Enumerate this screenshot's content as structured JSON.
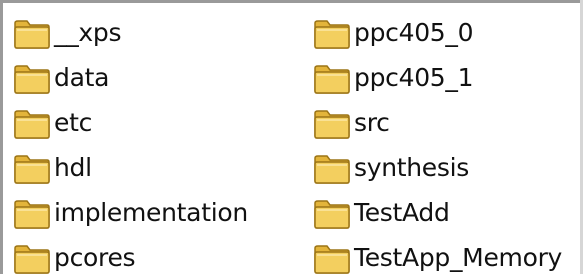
{
  "folders": {
    "left": [
      {
        "label": "__xps"
      },
      {
        "label": "data"
      },
      {
        "label": "etc"
      },
      {
        "label": "hdl"
      },
      {
        "label": "implementation"
      },
      {
        "label": "pcores"
      }
    ],
    "right": [
      {
        "label": "ppc405_0"
      },
      {
        "label": "ppc405_1"
      },
      {
        "label": "src"
      },
      {
        "label": "synthesis"
      },
      {
        "label": "TestAdd"
      },
      {
        "label": "TestApp_Memory"
      }
    ]
  },
  "icon": "folder-icon",
  "colors": {
    "folder_front": "#f3cf5f",
    "folder_back": "#e3b43a",
    "folder_outline": "#9c7516",
    "background": "#ffffff",
    "text": "#111111"
  }
}
